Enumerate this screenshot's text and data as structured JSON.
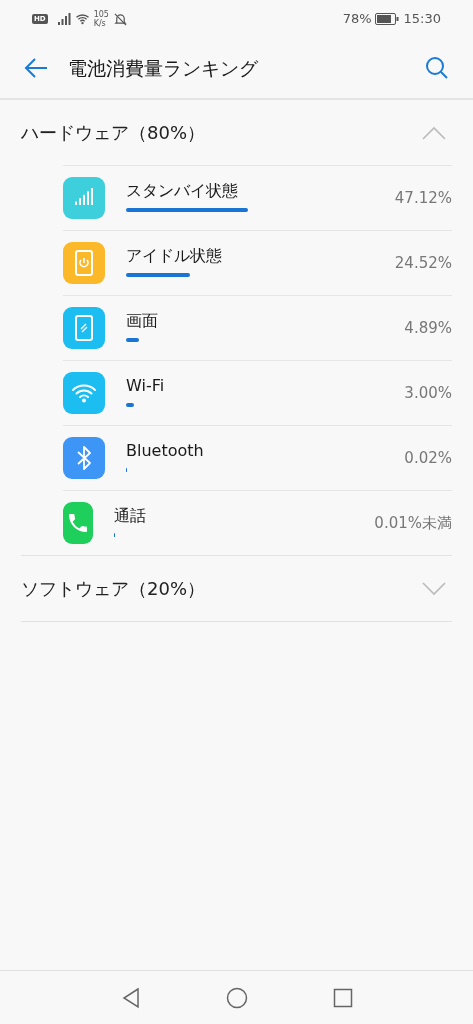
{
  "status_bar": {
    "badge": "HD",
    "speed_value": "105",
    "speed_unit": "K/s",
    "battery": "78%",
    "time": "15:30"
  },
  "header": {
    "title": "電池消費量ランキング"
  },
  "sections": [
    {
      "title": "ハードウェア（80%）",
      "expanded": true,
      "items": [
        {
          "kind": "signal",
          "color": "#3dcfdc",
          "name": "スタンバイ状態",
          "reading": "47.12%"
        },
        {
          "kind": "power",
          "color": "#fbb828",
          "name": "アイドル状態",
          "reading": "24.52%"
        },
        {
          "kind": "screen",
          "color": "#1cbdf0",
          "name": "画面",
          "reading": "4.89%"
        },
        {
          "kind": "wifi",
          "color": "#1cbdf0",
          "name": "Wi-Fi",
          "reading": "3.00%"
        },
        {
          "kind": "bluetooth",
          "color": "#3d95f5",
          "name": "Bluetooth",
          "reading": "0.02%"
        },
        {
          "kind": "phone",
          "color": "#1fcf5c",
          "name": "通話",
          "reading": "0.01%未満"
        }
      ]
    },
    {
      "title": "ソフトウェア（20%）",
      "expanded": false
    }
  ]
}
